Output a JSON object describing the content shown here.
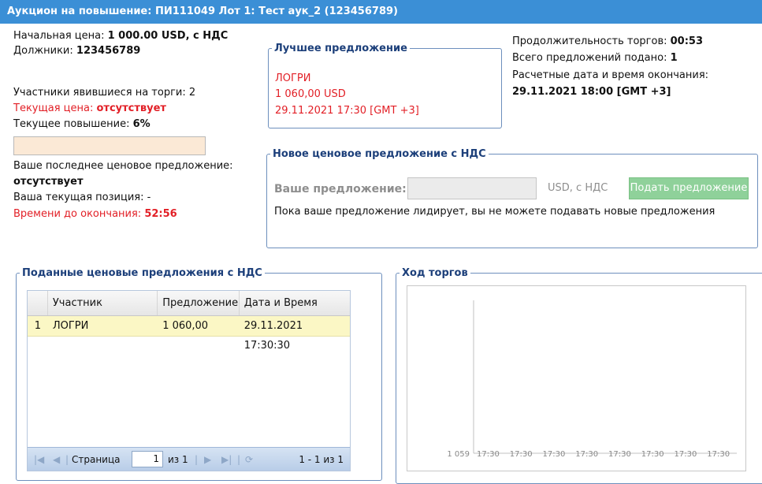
{
  "window": {
    "title": "Аукцион на повышение: ПИ111049 Лот 1: Тест аук_2 (123456789)"
  },
  "left_info": {
    "start_price_label": "Начальная цена: ",
    "start_price_value": "1 000.00 USD, с НДС",
    "debtors_label": "Должники: ",
    "debtors_value": "123456789",
    "participants": "Участники явившиеся на торги: 2",
    "current_price_label": "Текущая цена: ",
    "current_price_value": "отсутствует",
    "current_raise_label": "Текущее повышение: ",
    "current_raise_value": "6%",
    "last_offer_label": "Ваше последнее ценовое предложение:",
    "last_offer_value": "отсутствует",
    "position_text": "Ваша текущая позиция: -",
    "time_left_label": "Времени до окончания: ",
    "time_left_value": "52:56"
  },
  "best_offer": {
    "legend": "Лучшее предложение",
    "participant": "ЛОГРИ",
    "amount": "1 060,00 USD",
    "datetime": "29.11.2021 17:30 [GMT +3]"
  },
  "right_info": {
    "duration_label": "Продолжительность торгов: ",
    "duration_value": "00:53",
    "total_label": "Всего предложений подано: ",
    "total_value": "1",
    "end_label": "Расчетные дата и время окончания:",
    "end_value": "29.11.2021 18:00 [GMT +3]"
  },
  "new_offer": {
    "legend": "Новое ценовое предложение с НДС",
    "label": "Ваше предложение:",
    "input_value": "",
    "currency": "USD, с НДС",
    "submit_label": "Подать предложение",
    "notice": "Пока ваше предложение лидирует, вы не можете подавать новые предложения"
  },
  "bids": {
    "legend": "Поданные ценовые предложения с НДС",
    "columns": [
      "",
      "Участник",
      "Предложение",
      "Дата и Время"
    ],
    "rows": [
      {
        "num": "1",
        "participant": "ЛОГРИ",
        "offer": "1 060,00",
        "datetime": "29.11.2021 17:30:30"
      }
    ],
    "pager": {
      "page_label": "Страница",
      "page_value": "1",
      "of_label": "из 1",
      "summary": "1 - 1 из 1"
    }
  },
  "progress": {
    "legend": "Ход торгов"
  },
  "chart_data": {
    "type": "line",
    "title": "",
    "xlabel": "",
    "ylabel": "",
    "y_ticks": [
      "1 059"
    ],
    "x_ticks": [
      "17:30",
      "17:30",
      "17:30",
      "17:30",
      "17:30",
      "17:30",
      "17:30",
      "17:30"
    ],
    "series": []
  },
  "colors": {
    "titlebar": "#3b8fd6",
    "alert": "#e21f26",
    "legend": "#1c3f7a",
    "submit": "#8fd19a",
    "row_highlight": "#fbf7c5"
  }
}
